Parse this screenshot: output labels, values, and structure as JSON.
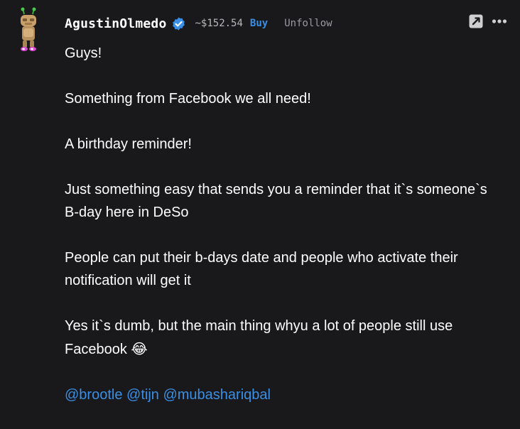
{
  "post": {
    "author": {
      "username": "AgustinOlmedo",
      "verified": true,
      "coin_price": "~$152.54",
      "buy_label": "Buy",
      "unfollow_label": "Unfollow"
    },
    "icons": {
      "avatar": "avatar-image",
      "verified": "verified-check-icon",
      "expand": "expand-arrow-icon",
      "more": "more-dots-icon"
    },
    "content": {
      "line_1": "Guys!",
      "line_2": "Something from Facebook we all need!",
      "line_3": "A birthday reminder!",
      "line_4": "Just something easy that sends you a reminder that it`s someone`s B-day here in DeSo",
      "line_5": "People can put their b-days date and people who activate their notification will get it",
      "line_6": "Yes it`s dumb, but the main thing whyu a lot of people still use Facebook",
      "line_6_emoji": "😂"
    },
    "mentions": [
      "@brootle",
      "@tijn",
      "@mubashariqbal"
    ]
  },
  "colors": {
    "background": "#19181a",
    "text": "#ffffff",
    "accent": "#3a8fe6",
    "muted": "#9a9aa0"
  }
}
